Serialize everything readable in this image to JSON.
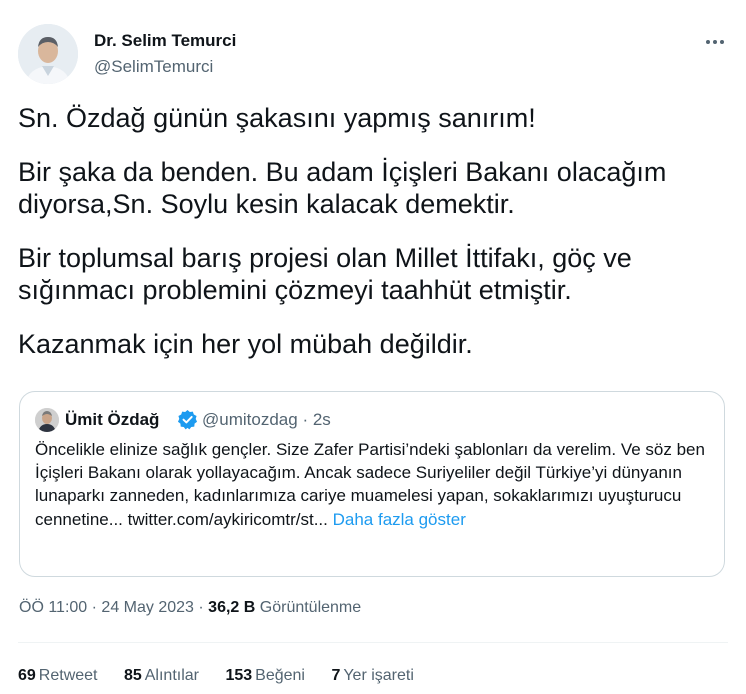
{
  "author": {
    "name": "Dr. Selim Temurci",
    "handle": "@SelimTemurci"
  },
  "tweet": {
    "paragraphs": [
      "Sn. Özdağ günün şakasını yapmış sanırım!",
      "Bir şaka da benden. Bu adam İçişleri Bakanı olacağım diyorsa,Sn. Soylu kesin kalacak demektir.",
      "Bir toplumsal barış projesi olan Millet İttifakı, göç ve sığınmacı problemini çözmeyi taahhüt etmiştir.",
      "Kazanmak için her yol mübah değildir."
    ]
  },
  "quote": {
    "name": "Ümit Özdağ",
    "handle": "@umitozdag",
    "separator": "·",
    "time": "2s",
    "text": "Öncelikle elinize sağlık gençler. Size Zafer Partisi’ndeki şablonları da verelim. Ve söz ben İçişleri Bakanı olarak yollayacağım. Ancak sadece Suriyeliler değil Türkiye’yi dünyanın lunaparkı zanneden, kadınlarımıza cariye muamelesi yapan, sokaklarımızı uyuşturucu cennetine... twitter.com/aykiricomtr/st...",
    "show_more": "Daha fazla göster"
  },
  "meta": {
    "time": "ÖÖ 11:00",
    "separator": "·",
    "date": "24 May 2023",
    "views_count": "36,2 B",
    "views_label": "Görüntülenme"
  },
  "stats": [
    {
      "count": "69",
      "label": "Retweet"
    },
    {
      "count": "85",
      "label": "Alıntılar"
    },
    {
      "count": "153",
      "label": "Beğeni"
    },
    {
      "count": "7",
      "label": "Yer işareti"
    }
  ],
  "colors": {
    "text": "#0f1419",
    "secondary": "#536471",
    "link": "#1d9bf0",
    "border": "#cfd9de"
  },
  "icons": {
    "more": "more-horizontal-icon",
    "verified": "verified-badge-icon"
  }
}
